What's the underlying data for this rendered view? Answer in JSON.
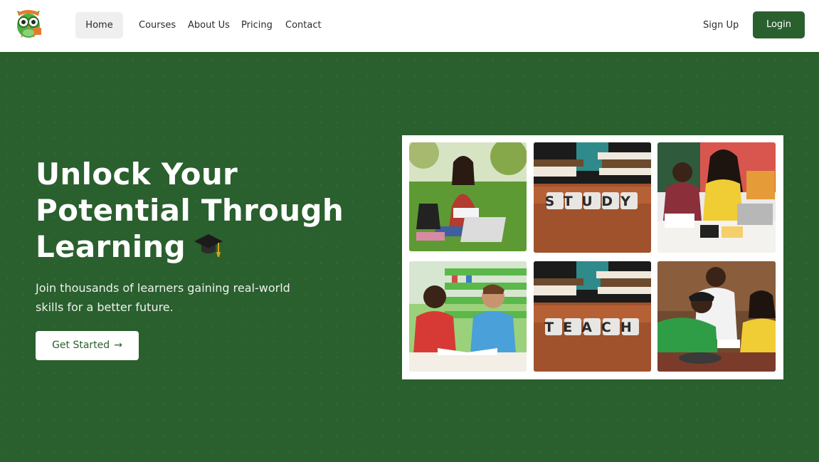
{
  "nav": {
    "home": "Home",
    "courses": "Courses",
    "about": "About Us",
    "pricing": "Pricing",
    "contact": "Contact",
    "signup": "Sign Up",
    "login": "Login"
  },
  "hero": {
    "title_lines": [
      "Unlock Your",
      "Potential Through",
      "Learning"
    ],
    "title_icon": "graduation-cap-icon",
    "subtitle_lines": [
      "Join thousands of learners gaining real-world",
      "skills for a better future."
    ],
    "cta_label": "Get Started",
    "cta_icon": "arrow-right-icon"
  },
  "gallery": {
    "tile_words": [
      "STUDY",
      "TEACH"
    ]
  },
  "colors": {
    "brand_green": "#2a5f2e",
    "white": "#ffffff",
    "nav_active_bg": "#efefef"
  }
}
